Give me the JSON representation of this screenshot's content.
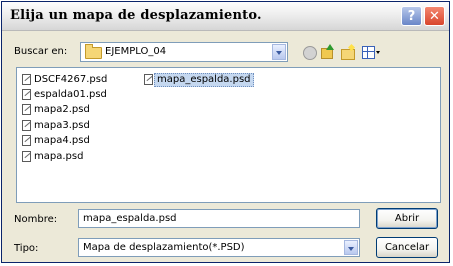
{
  "dialog": {
    "title": "Elija un mapa de desplazamiento.",
    "help_label": "?",
    "close_label": "✕"
  },
  "location": {
    "label": "Buscar en:",
    "value": "EJEMPLO_04",
    "icon": "folder-icon"
  },
  "toolbar": {
    "icons": [
      "back-icon",
      "up-folder-icon",
      "new-folder-icon",
      "views-menu-icon"
    ]
  },
  "files": [
    {
      "name": "DSCF4267.psd",
      "selected": false
    },
    {
      "name": "espalda01.psd",
      "selected": false
    },
    {
      "name": "mapa2.psd",
      "selected": false
    },
    {
      "name": "mapa3.psd",
      "selected": false
    },
    {
      "name": "mapa4.psd",
      "selected": false
    },
    {
      "name": "mapa.psd",
      "selected": false
    },
    {
      "name": "mapa_espalda.psd",
      "selected": true
    }
  ],
  "filename": {
    "label": "Nombre:",
    "value": "mapa_espalda.psd"
  },
  "filetype": {
    "label": "Tipo:",
    "value": "Mapa de desplazamiento(*.PSD)"
  },
  "buttons": {
    "open": "Abrir",
    "cancel": "Cancelar"
  }
}
